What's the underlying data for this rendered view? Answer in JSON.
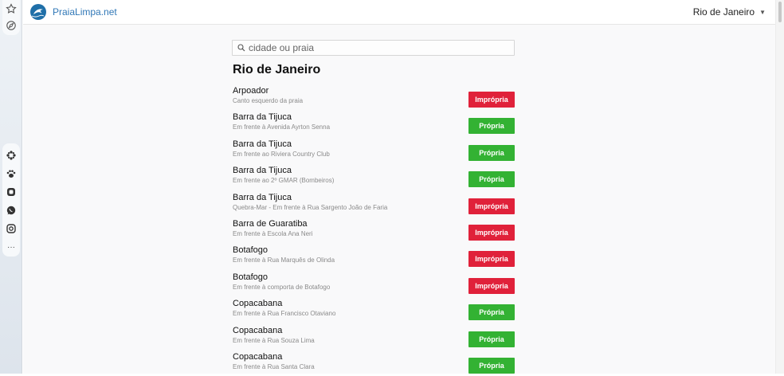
{
  "header": {
    "site_name": "PraiaLimpa.net",
    "city_selector": "Rio de Janeiro",
    "caret": "▼"
  },
  "search": {
    "placeholder": "cidade ou praia",
    "value": ""
  },
  "city_title": "Rio de Janeiro",
  "colors": {
    "impropria": "#e0213a",
    "propria": "#33b233",
    "brand": "#3178b7"
  },
  "beaches": [
    {
      "name": "Arpoador",
      "location": "Canto esquerdo da praia",
      "status": "Imprópria"
    },
    {
      "name": "Barra da Tijuca",
      "location": "Em frente à Avenida Ayrton Senna",
      "status": "Própria"
    },
    {
      "name": "Barra da Tijuca",
      "location": "Em frente ao Riviera Country Club",
      "status": "Própria"
    },
    {
      "name": "Barra da Tijuca",
      "location": "Em frente ao 2º GMAR (Bombeiros)",
      "status": "Própria"
    },
    {
      "name": "Barra da Tijuca",
      "location": "Quebra-Mar - Em frente à Rua Sargento João de Faria",
      "status": "Imprópria"
    },
    {
      "name": "Barra de Guaratiba",
      "location": "Em frente à Escola Ana Neri",
      "status": "Imprópria"
    },
    {
      "name": "Botafogo",
      "location": "Em frente à Rua Marquês de Olinda",
      "status": "Imprópria"
    },
    {
      "name": "Botafogo",
      "location": "Em frente à comporta de Botafogo",
      "status": "Imprópria"
    },
    {
      "name": "Copacabana",
      "location": "Em frente à Rua Francisco Otaviano",
      "status": "Própria"
    },
    {
      "name": "Copacabana",
      "location": "Em frente à Rua Souza Lima",
      "status": "Própria"
    },
    {
      "name": "Copacabana",
      "location": "Em frente à Rua Santa Clara",
      "status": "Própria"
    }
  ],
  "sidebar_icons": [
    "star-icon",
    "compass-icon",
    "pinwheel-icon",
    "paw-icon",
    "app-icon",
    "whatsapp-icon",
    "instagram-icon",
    "more-icon"
  ],
  "sidebar_more": "···"
}
